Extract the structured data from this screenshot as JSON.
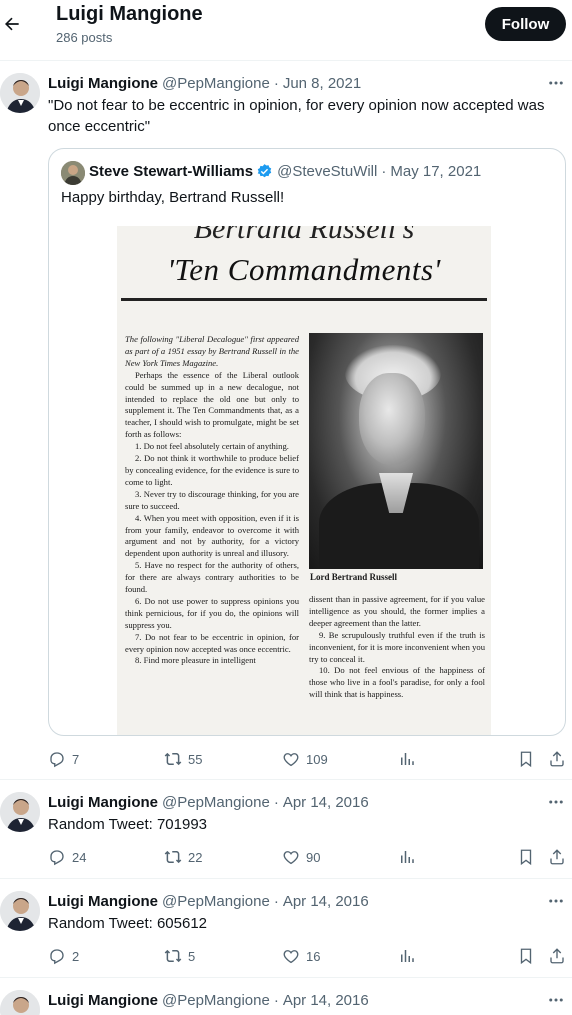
{
  "header": {
    "title": "Luigi Mangione",
    "posts_count": "286 posts",
    "follow_label": "Follow"
  },
  "tweets": [
    {
      "name": "Luigi Mangione",
      "handle": "@PepMangione",
      "separator": "·",
      "date": "Jun 8, 2021",
      "text": "\"Do not fear to be eccentric in opinion, for every opinion now accepted was once eccentric\"",
      "quote": {
        "name": "Steve Stewart-Williams",
        "handle": "@SteveStuWill",
        "separator": "·",
        "date": "May 17, 2021",
        "text": "Happy birthday, Bertrand Russell!",
        "image": {
          "top_text": "Bertrand Russell's",
          "title": "'Ten Commandments'",
          "intro": "The following \"Liberal Decalogue\" first appeared as part of a 1951 essay by Bertrand Russell in the New York Times Magazine.",
          "p1": "Perhaps the essence of the Liberal outlook could be summed up in a new decalogue, not intended to replace the old one but only to supplement it. The Ten Commandments that, as a teacher, I should wish to promulgate, might be set forth as follows:",
          "c1": "1. Do not feel absolutely certain of anything.",
          "c2": "2. Do not think it worthwhile to produce belief by concealing evidence, for the evidence is sure to come to light.",
          "c3": "3. Never try to discourage thinking, for you are sure to succeed.",
          "c4": "4. When you meet with opposition, even if it is from your family, endeavor to overcome it with argument and not by authority, for a victory dependent upon authority is unreal and illusory.",
          "c5": "5. Have no respect for the authority of others, for there are always contrary authorities to be found.",
          "c6": "6. Do not use power to suppress opinions you think pernicious, for if you do, the opinions will suppress you.",
          "c7": "7. Do not fear to be eccentric in opinion, for every opinion now accepted was once eccentric.",
          "c8": "8. Find more pleasure in intelligent",
          "caption": "Lord Bertrand Russell",
          "r1": "dissent than in passive agreement, for if you value intelligence as you should, the former implies a deeper agreement than the latter.",
          "c9": "9. Be scrupulously truthful even if the truth is inconvenient, for it is more inconvenient when you try to conceal it.",
          "c10": "10. Do not feel envious of the happiness of those who live in a fool's paradise, for only a fool will think that is happiness."
        }
      },
      "replies": "7",
      "reposts": "55",
      "likes": "109"
    },
    {
      "name": "Luigi Mangione",
      "handle": "@PepMangione",
      "separator": "·",
      "date": "Apr 14, 2016",
      "text": "Random Tweet: 701993",
      "replies": "24",
      "reposts": "22",
      "likes": "90"
    },
    {
      "name": "Luigi Mangione",
      "handle": "@PepMangione",
      "separator": "·",
      "date": "Apr 14, 2016",
      "text": "Random Tweet: 605612",
      "replies": "2",
      "reposts": "5",
      "likes": "16"
    },
    {
      "name": "Luigi Mangione",
      "handle": "@PepMangione",
      "separator": "·",
      "date": "Apr 14, 2016"
    }
  ],
  "icons": {
    "back": "arrow-left-icon",
    "more": "more-horizontal-icon",
    "reply": "reply-icon",
    "repost": "repost-icon",
    "like": "heart-icon",
    "views": "views-icon",
    "bookmark": "bookmark-icon",
    "share": "share-icon",
    "verified": "verified-badge-icon"
  },
  "colors": {
    "text": "#0f1419",
    "secondary": "#536471",
    "border": "#eff3f4",
    "verified": "#1d9bf0",
    "follow_bg": "#0f1419"
  }
}
